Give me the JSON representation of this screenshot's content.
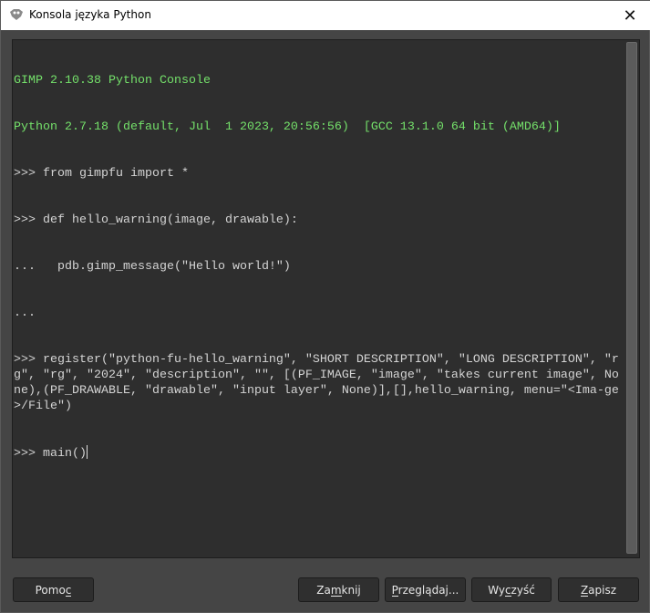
{
  "window": {
    "title": "Konsola języka Python",
    "close_icon": "close-icon",
    "app_icon": "gimp-icon"
  },
  "console": {
    "banner": [
      "GIMP 2.10.38 Python Console",
      "Python 2.7.18 (default, Jul  1 2023, 20:56:56)  [GCC 13.1.0 64 bit (AMD64)]"
    ],
    "lines": [
      ">>> from gimpfu import *",
      ">>> def hello_warning(image, drawable):",
      "...   pdb.gimp_message(\"Hello world!\")",
      "...",
      ">>> register(\"python-fu-hello_warning\", \"SHORT DESCRIPTION\", \"LONG DESCRIPTION\", \"rg\", \"rg\", \"2024\", \"description\", \"\", [(PF_IMAGE, \"image\", \"takes current image\", None),(PF_DRAWABLE, \"drawable\", \"input layer\", None)],[],hello_warning, menu=\"<Ima-ge>/File\")"
    ],
    "input": ">>> main()"
  },
  "buttons": {
    "help": {
      "label": "Pomoc",
      "mnemonic": 4
    },
    "close": {
      "label": "Zamknij",
      "mnemonic": 2
    },
    "browse": {
      "label": "Przeglądaj...",
      "mnemonic": 0
    },
    "clear": {
      "label": "Wyczyść",
      "mnemonic": 2
    },
    "save": {
      "label": "Zapisz",
      "mnemonic": 0
    }
  }
}
